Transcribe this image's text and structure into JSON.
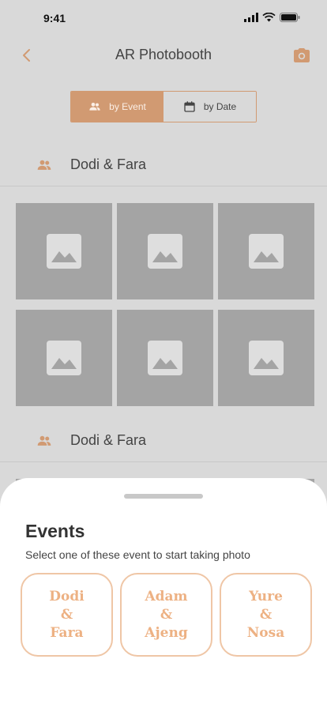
{
  "status": {
    "time": "9:41"
  },
  "header": {
    "title": "AR Photobooth",
    "back_icon": "chevron-left-icon",
    "camera_icon": "camera-icon"
  },
  "filter": {
    "by_event_label": "by Event",
    "by_date_label": "by Date",
    "selected": "by Event"
  },
  "groups": [
    {
      "name": "Dodi & Fara",
      "photo_count": 6
    },
    {
      "name": "Dodi & Fara"
    }
  ],
  "sheet": {
    "title": "Events",
    "subtitle": "Select one of these event to start taking photo",
    "events": [
      {
        "label": "Dodi\n&\nFara"
      },
      {
        "label": "Adam\n&\nAjeng"
      },
      {
        "label": "Yure\n&\nNosa"
      }
    ]
  },
  "colors": {
    "accent": "#d19a72",
    "card_border": "#efc6a6",
    "card_text": "#edb183",
    "placeholder": "#a4a4a4",
    "dim_background": "#d9d9d9"
  }
}
